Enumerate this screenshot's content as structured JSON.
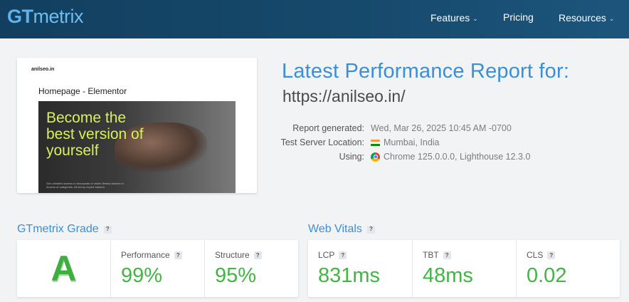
{
  "header": {
    "logo_part1": "GT",
    "logo_part2": "metrix",
    "nav": [
      {
        "label": "Features",
        "has_dropdown": true
      },
      {
        "label": "Pricing",
        "has_dropdown": false
      },
      {
        "label": "Resources",
        "has_dropdown": true
      }
    ]
  },
  "thumbnail": {
    "site": "anilseo.in",
    "page_title": "Homepage - Elementor",
    "hero_text": "Become the best version of yourself",
    "hero_small": "Get unlimited access to thousands of online fitness classes in dozens of categories. All led by expert trainers."
  },
  "report": {
    "heading": "Latest Performance Report for:",
    "url": "https://anilseo.in/",
    "meta": [
      {
        "label": "Report generated:",
        "value": "Wed, Mar 26, 2025 10:45 AM -0700",
        "icon": ""
      },
      {
        "label": "Test Server Location:",
        "value": "Mumbai, India",
        "icon": "india-flag-icon"
      },
      {
        "label": "Using:",
        "value": "Chrome 125.0.0.0, Lighthouse 12.3.0",
        "icon": "chrome-icon"
      }
    ]
  },
  "grade": {
    "title": "GTmetrix Grade",
    "help": "?",
    "letter": "A",
    "performance_label": "Performance",
    "performance_value": "99%",
    "structure_label": "Structure",
    "structure_value": "95%"
  },
  "vitals": {
    "title": "Web Vitals",
    "help": "?",
    "lcp_label": "LCP",
    "lcp_value": "831ms",
    "tbt_label": "TBT",
    "tbt_value": "48ms",
    "cls_label": "CLS",
    "cls_value": "0.02"
  },
  "colors": {
    "accent": "#3a8fd9",
    "good": "#44b444",
    "header": "#16496c"
  }
}
